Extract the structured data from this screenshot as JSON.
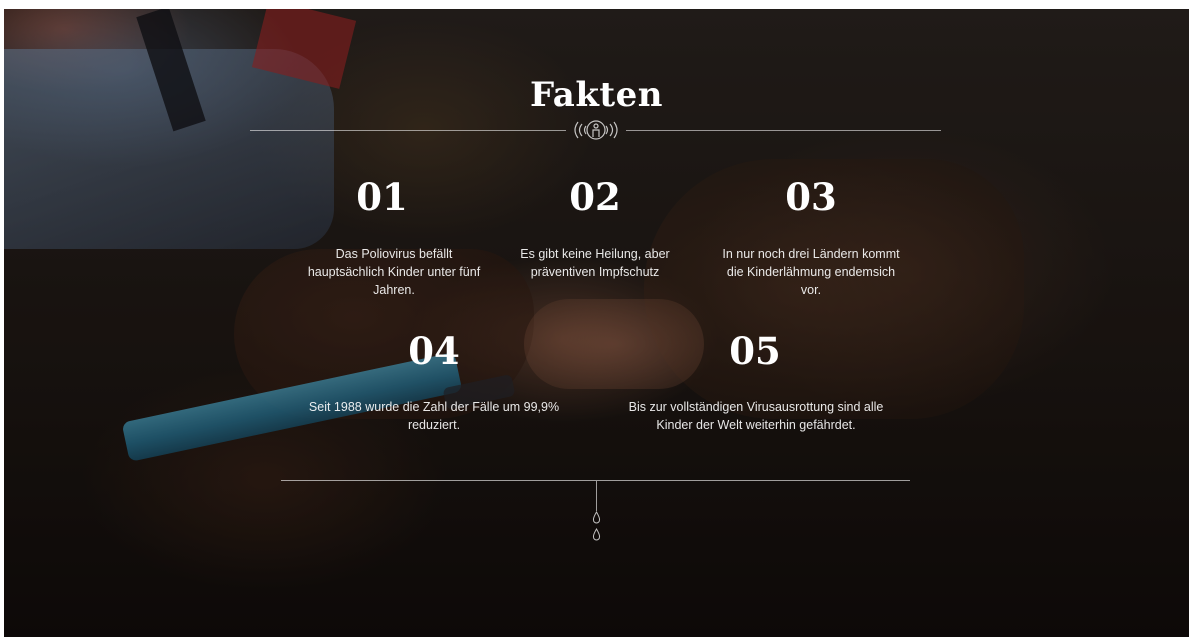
{
  "section": {
    "title": "Fakten"
  },
  "facts": [
    {
      "number": "01",
      "lines": [
        "Das Poliovirus befällt",
        "hauptsächlich Kinder unter fünf",
        "Jahren."
      ]
    },
    {
      "number": "02",
      "lines": [
        "Es gibt keine Heilung, aber",
        "präventiven Impfschutz"
      ]
    },
    {
      "number": "03",
      "lines": [
        "In nur noch drei Ländern kommt",
        "die Kinderlähmung endemsich",
        "vor."
      ]
    },
    {
      "number": "04",
      "lines": [
        "Seit 1988 wurde die Zahl der Fälle um 99,9%",
        "reduziert."
      ]
    },
    {
      "number": "05",
      "lines": [
        "Bis zur vollständigen Virusausrottung sind alle",
        "Kinder der Welt weiterhin gefährdet."
      ]
    }
  ],
  "icons": {
    "emblem": "signal-person-icon",
    "drop": "water-drop-icon"
  },
  "colors": {
    "text": "#ffffff",
    "divider": "#ffffff"
  }
}
